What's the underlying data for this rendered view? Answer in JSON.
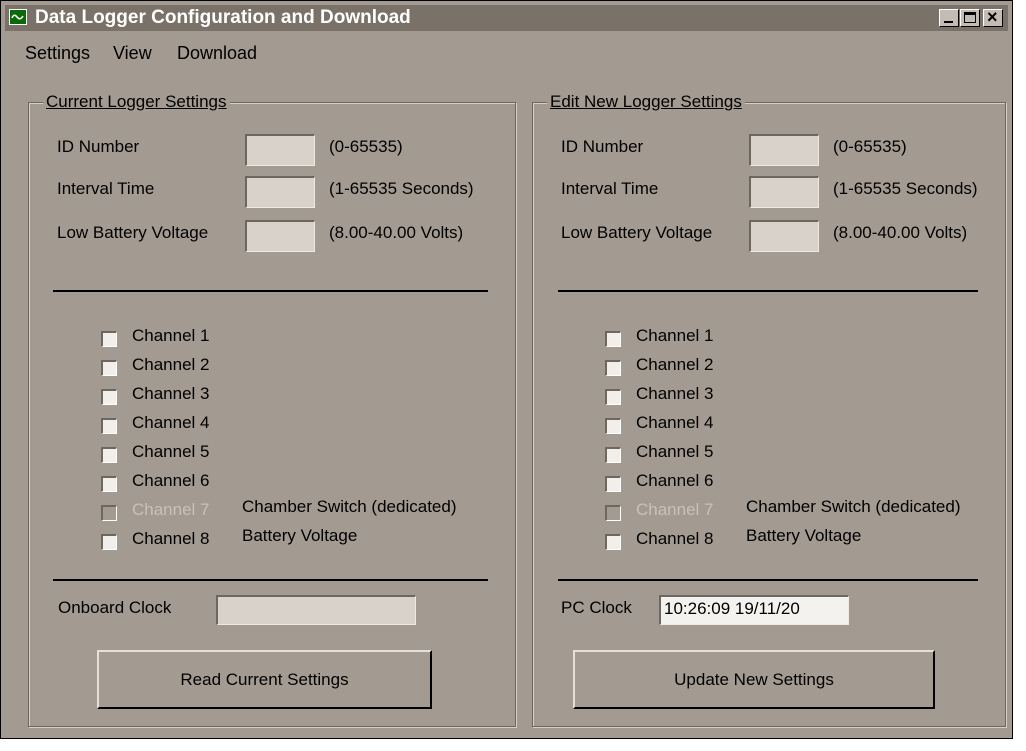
{
  "window": {
    "title": "Data Logger Configuration and Download",
    "controls": {
      "minimize": "_",
      "maximize": "□",
      "close": "×"
    }
  },
  "menu": [
    "Settings",
    "View",
    "Download"
  ],
  "current": {
    "group_title": "Current Logger Settings",
    "fields": [
      {
        "label": "ID Number",
        "range": "(0-65535)",
        "value": ""
      },
      {
        "label": "Interval Time",
        "range": "(1-65535 Seconds)",
        "value": ""
      },
      {
        "label": "Low Battery Voltage",
        "range": "(8.00-40.00 Volts)",
        "value": ""
      }
    ],
    "channels": [
      {
        "label": "Channel 1",
        "note": ""
      },
      {
        "label": "Channel 2",
        "note": ""
      },
      {
        "label": "Channel 3",
        "note": ""
      },
      {
        "label": "Channel 4",
        "note": ""
      },
      {
        "label": "Channel 5",
        "note": ""
      },
      {
        "label": "Channel 6",
        "note": ""
      },
      {
        "label": "Channel 7",
        "note": "Chamber Switch (dedicated)"
      },
      {
        "label": "Channel 8",
        "note": "Battery Voltage"
      }
    ],
    "clock_label": "Onboard Clock",
    "clock_value": "",
    "button": "Read Current Settings"
  },
  "new": {
    "group_title": "Edit New Logger Settings",
    "fields": [
      {
        "label": "ID Number",
        "range": "(0-65535)",
        "value": ""
      },
      {
        "label": "Interval Time",
        "range": "(1-65535 Seconds)",
        "value": ""
      },
      {
        "label": "Low Battery Voltage",
        "range": "(8.00-40.00 Volts)",
        "value": ""
      }
    ],
    "channels": [
      {
        "label": "Channel 1",
        "note": ""
      },
      {
        "label": "Channel 2",
        "note": ""
      },
      {
        "label": "Channel 3",
        "note": ""
      },
      {
        "label": "Channel 4",
        "note": ""
      },
      {
        "label": "Channel 5",
        "note": ""
      },
      {
        "label": "Channel 6",
        "note": ""
      },
      {
        "label": "Channel 7",
        "note": "Chamber Switch (dedicated)"
      },
      {
        "label": "Channel 8",
        "note": "Battery Voltage"
      }
    ],
    "clock_label": "PC Clock",
    "clock_value": "10:26:09  19/11/20",
    "button": "Update New Settings"
  },
  "colors": {
    "face": "#a39b92",
    "title_bar": "#7a7268",
    "disabled_text": "#c7c1b9"
  }
}
